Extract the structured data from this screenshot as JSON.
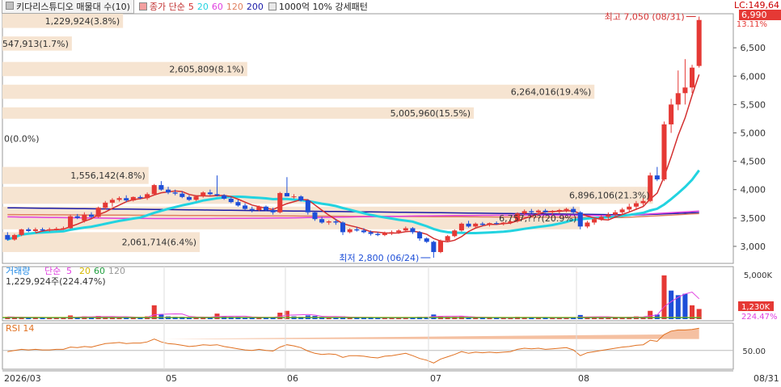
{
  "header": {
    "stock_name": "키다리스튜디오 매물대 수(10)",
    "ma_label": "종가 단순",
    "ma_periods": [
      {
        "label": "5",
        "color": "#d32f2f"
      },
      {
        "label": "20",
        "color": "#22d3e0"
      },
      {
        "label": "60",
        "color": "#e040e0"
      },
      {
        "label": "120",
        "color": "#e08060"
      },
      {
        "label": "200",
        "color": "#1a1aa8"
      }
    ],
    "pattern_label": "1000억 10% 강세패턴",
    "lc_label": "LC:149,64"
  },
  "price_panel": {
    "current_price": "6,990",
    "current_pct": "13.11%",
    "high_label": "최고 7,050 (08/31)",
    "low_label": "최저 2,800 (06/24)",
    "y_ticks": [
      "6,500",
      "6,000",
      "5,500",
      "5,000",
      "4,500",
      "4,000",
      "3,500",
      "3,000"
    ]
  },
  "volume_panel": {
    "title": "거래량",
    "ma_label": "단순",
    "ma_periods": [
      {
        "label": "5",
        "color": "#e040e0"
      },
      {
        "label": "20",
        "color": "#d6b800"
      },
      {
        "label": "60",
        "color": "#22a040"
      },
      {
        "label": "120",
        "color": "#999999"
      }
    ],
    "last_value_label": "1,229,924주(224.47%)",
    "y_tick": "5,000K",
    "current_tag": "1,230K",
    "current_pct": "224.47%"
  },
  "rsi_panel": {
    "title": "RSI 14",
    "y_tick": "50.00"
  },
  "x_axis": {
    "labels": [
      "2026/03",
      "05",
      "06",
      "07",
      "08",
      "08/31"
    ]
  },
  "chart_data": {
    "type": "candlestick",
    "ylim": [
      2700,
      7100
    ],
    "volume_profile": [
      {
        "label": "1,229,924(3.8%)",
        "price_low": 6850,
        "price_high": 7100,
        "width_frac": 0.165
      },
      {
        "label": "547,913(1.7%)",
        "price_low": 6450,
        "price_high": 6700,
        "width_frac": 0.095
      },
      {
        "label": "2,605,809(8.1%)",
        "price_low": 6000,
        "price_high": 6250,
        "width_frac": 0.335
      },
      {
        "label": "6,264,016(19.4%)",
        "price_low": 5600,
        "price_high": 5850,
        "width_frac": 0.81
      },
      {
        "label": "5,005,960(15.5%)",
        "price_low": 5250,
        "price_high": 5450,
        "width_frac": 0.645
      },
      {
        "label": "0(0.0%)",
        "price_low": 4800,
        "price_high": 5000,
        "width_frac": 0.0
      },
      {
        "label": "1,556,142(4.8%)",
        "price_low": 4100,
        "price_high": 4400,
        "width_frac": 0.2
      },
      {
        "label": "6,896,106(21.3%)",
        "price_low": 3750,
        "price_high": 4050,
        "width_frac": 0.89
      },
      {
        "label": "6,757,???(20.9%)",
        "price_low": 3300,
        "price_high": 3700,
        "width_frac": 0.79
      },
      {
        "label": "2,061,714(6.4%)",
        "price_low": 2900,
        "price_high": 3250,
        "width_frac": 0.27
      }
    ],
    "candles": [
      [
        3200,
        3250,
        3100,
        3120
      ],
      [
        3120,
        3220,
        3100,
        3200
      ],
      [
        3200,
        3310,
        3180,
        3300
      ],
      [
        3300,
        3330,
        3250,
        3270
      ],
      [
        3270,
        3330,
        3250,
        3300
      ],
      [
        3300,
        3330,
        3270,
        3280
      ],
      [
        3280,
        3330,
        3260,
        3300
      ],
      [
        3300,
        3340,
        3280,
        3310
      ],
      [
        3310,
        3350,
        3290,
        3320
      ],
      [
        3320,
        3560,
        3310,
        3530
      ],
      [
        3530,
        3570,
        3480,
        3500
      ],
      [
        3450,
        3600,
        3420,
        3560
      ],
      [
        3560,
        3600,
        3500,
        3520
      ],
      [
        3520,
        3700,
        3500,
        3680
      ],
      [
        3680,
        3800,
        3650,
        3770
      ],
      [
        3770,
        3850,
        3700,
        3820
      ],
      [
        3820,
        3880,
        3790,
        3850
      ],
      [
        3850,
        3900,
        3780,
        3810
      ],
      [
        3810,
        3880,
        3790,
        3870
      ],
      [
        3870,
        3900,
        3830,
        3850
      ],
      [
        3850,
        3950,
        3820,
        3920
      ],
      [
        3920,
        4100,
        3900,
        4080
      ],
      [
        4080,
        4150,
        3980,
        4000
      ],
      [
        4000,
        4050,
        3920,
        3950
      ],
      [
        3950,
        4000,
        3900,
        3930
      ],
      [
        3930,
        3970,
        3850,
        3870
      ],
      [
        3870,
        3900,
        3800,
        3820
      ],
      [
        3820,
        3900,
        3800,
        3880
      ],
      [
        3880,
        3970,
        3860,
        3950
      ],
      [
        3950,
        4000,
        3900,
        3920
      ],
      [
        3920,
        4250,
        3880,
        3900
      ],
      [
        3900,
        3920,
        3820,
        3840
      ],
      [
        3840,
        3870,
        3760,
        3780
      ],
      [
        3780,
        3820,
        3700,
        3720
      ],
      [
        3720,
        3760,
        3640,
        3660
      ],
      [
        3660,
        3700,
        3600,
        3640
      ],
      [
        3640,
        3720,
        3620,
        3700
      ],
      [
        3700,
        3720,
        3620,
        3640
      ],
      [
        3640,
        3680,
        3560,
        3600
      ],
      [
        3600,
        3960,
        3580,
        3940
      ],
      [
        3940,
        4220,
        3880,
        3880
      ],
      [
        3880,
        3920,
        3840,
        3880
      ],
      [
        3880,
        3900,
        3790,
        3810
      ],
      [
        3810,
        3830,
        3560,
        3600
      ],
      [
        3600,
        3620,
        3450,
        3480
      ],
      [
        3480,
        3520,
        3400,
        3420
      ],
      [
        3420,
        3460,
        3380,
        3440
      ],
      [
        3440,
        3480,
        3380,
        3420
      ],
      [
        3420,
        3440,
        3200,
        3250
      ],
      [
        3250,
        3320,
        3230,
        3300
      ],
      [
        3300,
        3340,
        3260,
        3280
      ],
      [
        3280,
        3320,
        3230,
        3250
      ],
      [
        3250,
        3280,
        3190,
        3220
      ],
      [
        3220,
        3250,
        3180,
        3200
      ],
      [
        3200,
        3260,
        3180,
        3240
      ],
      [
        3240,
        3280,
        3200,
        3250
      ],
      [
        3250,
        3300,
        3220,
        3280
      ],
      [
        3280,
        3350,
        3250,
        3320
      ],
      [
        3320,
        3340,
        3220,
        3250
      ],
      [
        3250,
        3270,
        3100,
        3140
      ],
      [
        3140,
        3160,
        3060,
        3080
      ],
      [
        3080,
        3100,
        2800,
        2900
      ],
      [
        2900,
        3120,
        2880,
        3100
      ],
      [
        3100,
        3200,
        3080,
        3180
      ],
      [
        3180,
        3300,
        3160,
        3280
      ],
      [
        3280,
        3420,
        3260,
        3400
      ],
      [
        3400,
        3450,
        3330,
        3350
      ],
      [
        3350,
        3420,
        3330,
        3400
      ],
      [
        3400,
        3430,
        3360,
        3380
      ],
      [
        3380,
        3420,
        3350,
        3410
      ],
      [
        3410,
        3440,
        3380,
        3400
      ],
      [
        3400,
        3430,
        3370,
        3420
      ],
      [
        3420,
        3460,
        3390,
        3440
      ],
      [
        3440,
        3600,
        3420,
        3580
      ],
      [
        3580,
        3650,
        3550,
        3620
      ],
      [
        3620,
        3660,
        3580,
        3600
      ],
      [
        3600,
        3650,
        3570,
        3630
      ],
      [
        3630,
        3660,
        3590,
        3600
      ],
      [
        3600,
        3640,
        3560,
        3620
      ],
      [
        3620,
        3660,
        3580,
        3640
      ],
      [
        3640,
        3680,
        3600,
        3660
      ],
      [
        3660,
        3700,
        3580,
        3600
      ],
      [
        3600,
        3620,
        3300,
        3350
      ],
      [
        3350,
        3450,
        3320,
        3420
      ],
      [
        3420,
        3500,
        3380,
        3480
      ],
      [
        3480,
        3550,
        3450,
        3520
      ],
      [
        3520,
        3600,
        3480,
        3560
      ],
      [
        3560,
        3640,
        3520,
        3600
      ],
      [
        3600,
        3680,
        3560,
        3650
      ],
      [
        3650,
        3750,
        3600,
        3700
      ],
      [
        3700,
        3800,
        3640,
        3760
      ],
      [
        3760,
        3850,
        3720,
        3800
      ],
      [
        3800,
        4300,
        3780,
        4250
      ],
      [
        4250,
        4400,
        4150,
        4180
      ],
      [
        4180,
        5200,
        4150,
        5150
      ],
      [
        5150,
        5600,
        5000,
        5500
      ],
      [
        5500,
        6100,
        5400,
        5700
      ],
      [
        5700,
        6300,
        5500,
        5800
      ],
      [
        5800,
        6200,
        5700,
        6150
      ],
      [
        6180,
        7050,
        6150,
        6990
      ]
    ],
    "volume": [
      [
        "r",
        5
      ],
      [
        "r",
        4
      ],
      [
        "r",
        4
      ],
      [
        "b",
        3
      ],
      [
        "r",
        4
      ],
      [
        "b",
        3
      ],
      [
        "r",
        3
      ],
      [
        "r",
        4
      ],
      [
        "r",
        3
      ],
      [
        "r",
        8
      ],
      [
        "b",
        4
      ],
      [
        "r",
        6
      ],
      [
        "b",
        4
      ],
      [
        "r",
        7
      ],
      [
        "r",
        6
      ],
      [
        "r",
        5
      ],
      [
        "r",
        4
      ],
      [
        "b",
        4
      ],
      [
        "r",
        4
      ],
      [
        "b",
        3
      ],
      [
        "r",
        6
      ],
      [
        "r",
        30
      ],
      [
        "b",
        10
      ],
      [
        "b",
        6
      ],
      [
        "b",
        5
      ],
      [
        "b",
        5
      ],
      [
        "b",
        4
      ],
      [
        "r",
        4
      ],
      [
        "r",
        5
      ],
      [
        "b",
        4
      ],
      [
        "r",
        12
      ],
      [
        "b",
        6
      ],
      [
        "b",
        5
      ],
      [
        "b",
        5
      ],
      [
        "b",
        4
      ],
      [
        "b",
        4
      ],
      [
        "r",
        4
      ],
      [
        "b",
        3
      ],
      [
        "b",
        4
      ],
      [
        "r",
        14
      ],
      [
        "r",
        18
      ],
      [
        "b",
        6
      ],
      [
        "b",
        5
      ],
      [
        "b",
        8
      ],
      [
        "b",
        7
      ],
      [
        "b",
        5
      ],
      [
        "r",
        4
      ],
      [
        "b",
        4
      ],
      [
        "b",
        6
      ],
      [
        "r",
        4
      ],
      [
        "b",
        3
      ],
      [
        "b",
        3
      ],
      [
        "b",
        3
      ],
      [
        "b",
        3
      ],
      [
        "r",
        3
      ],
      [
        "r",
        3
      ],
      [
        "r",
        3
      ],
      [
        "r",
        4
      ],
      [
        "b",
        4
      ],
      [
        "b",
        5
      ],
      [
        "b",
        5
      ],
      [
        "b",
        10
      ],
      [
        "r",
        7
      ],
      [
        "r",
        5
      ],
      [
        "r",
        5
      ],
      [
        "r",
        6
      ],
      [
        "b",
        4
      ],
      [
        "r",
        3
      ],
      [
        "b",
        3
      ],
      [
        "r",
        3
      ],
      [
        "b",
        3
      ],
      [
        "r",
        3
      ],
      [
        "r",
        3
      ],
      [
        "r",
        5
      ],
      [
        "r",
        4
      ],
      [
        "b",
        3
      ],
      [
        "r",
        3
      ],
      [
        "b",
        3
      ],
      [
        "r",
        3
      ],
      [
        "r",
        3
      ],
      [
        "r",
        3
      ],
      [
        "b",
        4
      ],
      [
        "b",
        9
      ],
      [
        "r",
        5
      ],
      [
        "r",
        4
      ],
      [
        "r",
        4
      ],
      [
        "r",
        4
      ],
      [
        "r",
        4
      ],
      [
        "r",
        4
      ],
      [
        "r",
        5
      ],
      [
        "r",
        6
      ],
      [
        "r",
        5
      ],
      [
        "r",
        18
      ],
      [
        "b",
        10
      ],
      [
        "r",
        95
      ],
      [
        "b",
        62
      ],
      [
        "b",
        52
      ],
      [
        "b",
        55
      ],
      [
        "r",
        30
      ],
      [
        "r",
        22
      ]
    ],
    "rsi": [
      48,
      50,
      52,
      51,
      52,
      51,
      51,
      52,
      52,
      56,
      55,
      57,
      56,
      59,
      62,
      63,
      64,
      62,
      63,
      63,
      65,
      70,
      65,
      62,
      61,
      59,
      57,
      58,
      60,
      59,
      60,
      57,
      55,
      53,
      51,
      50,
      52,
      50,
      49,
      56,
      60,
      58,
      55,
      49,
      45,
      43,
      44,
      43,
      38,
      41,
      41,
      40,
      38,
      37,
      40,
      41,
      43,
      45,
      41,
      36,
      33,
      28,
      35,
      39,
      43,
      48,
      45,
      47,
      46,
      47,
      46,
      47,
      48,
      52,
      54,
      53,
      54,
      52,
      53,
      54,
      55,
      51,
      41,
      46,
      48,
      50,
      52,
      54,
      56,
      57,
      59,
      60,
      68,
      66,
      78,
      84,
      86,
      86,
      87,
      89
    ]
  }
}
